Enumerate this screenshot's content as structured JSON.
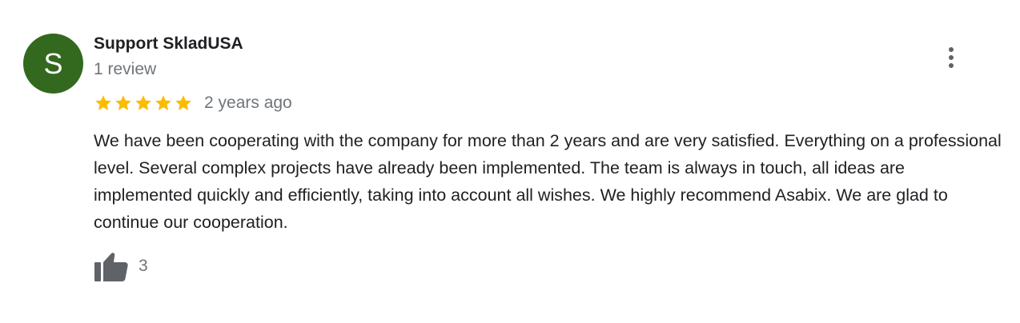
{
  "review": {
    "avatar_letter": "S",
    "avatar_color": "#33691e",
    "author_name": "Support SkladUSA",
    "author_meta": "1 review",
    "rating": 5,
    "max_rating": 5,
    "star_color": "#fbbc04",
    "date": "2 years ago",
    "text": "We have been cooperating with the company for more than 2 years and are very satisfied. Everything on a professional level. Several complex projects have already been implemented. The team is always in touch, all ideas are implemented quickly and efficiently, taking into account all wishes. We highly recommend Asabix. We are glad to continue our cooperation.",
    "likes": "3",
    "icons": {
      "menu": "more-vertical-icon",
      "like": "thumbs-up-icon",
      "star": "star-icon"
    }
  }
}
